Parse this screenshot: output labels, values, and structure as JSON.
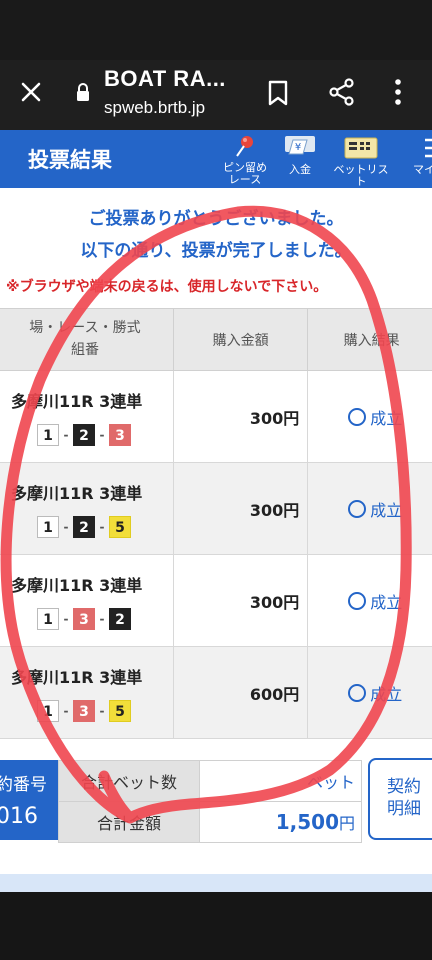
{
  "browser": {
    "site_title": "BOAT RA...",
    "url": "spweb.brtb.jp",
    "icons": {
      "close": "close-icon",
      "lock": "lock-icon",
      "bookmark": "bookmark-icon",
      "share": "share-icon",
      "menu": "more-vert-icon"
    }
  },
  "header": {
    "title": "投票結果",
    "pin_label_1": "ピン留め",
    "pin_label_2": "レース",
    "deposit_label": "入金",
    "betlist_label": "ベットリスト",
    "my_label": "マイ"
  },
  "messages": {
    "thanks": "ご投票ありがとうございました。",
    "complete": "以下の通り、投票が完了しました。",
    "warning": "※ブラウザや端末の戻るは、使用しないで下さい。"
  },
  "table": {
    "col1_line1": "場・レース・勝式",
    "col1_line2": "組番",
    "col2": "購入金額",
    "col3": "購入結果",
    "rows": [
      {
        "race": "多摩川11R 3連単",
        "combo": [
          "1",
          "2",
          "3"
        ],
        "amount": "300円",
        "result": "成立"
      },
      {
        "race": "多摩川11R 3連単",
        "combo": [
          "1",
          "2",
          "5"
        ],
        "amount": "300円",
        "result": "成立"
      },
      {
        "race": "多摩川11R 3連単",
        "combo": [
          "1",
          "3",
          "2"
        ],
        "amount": "300円",
        "result": "成立"
      },
      {
        "race": "多摩川11R 3連単",
        "combo": [
          "1",
          "3",
          "5"
        ],
        "amount": "600円",
        "result": "成立"
      }
    ]
  },
  "summary": {
    "contract_label": "約番号",
    "contract_value": "016",
    "bet_count_label": "合計ベット数",
    "bet_count_value": "ベット",
    "total_label": "合計金額",
    "total_value": "1,500",
    "total_unit": "円",
    "detail_line1": "契約",
    "detail_line2": "明細"
  },
  "annotation": {
    "color": "#f0464f"
  },
  "colors": {
    "brand_blue": "#2465c8",
    "warning_red": "#d8262a"
  }
}
